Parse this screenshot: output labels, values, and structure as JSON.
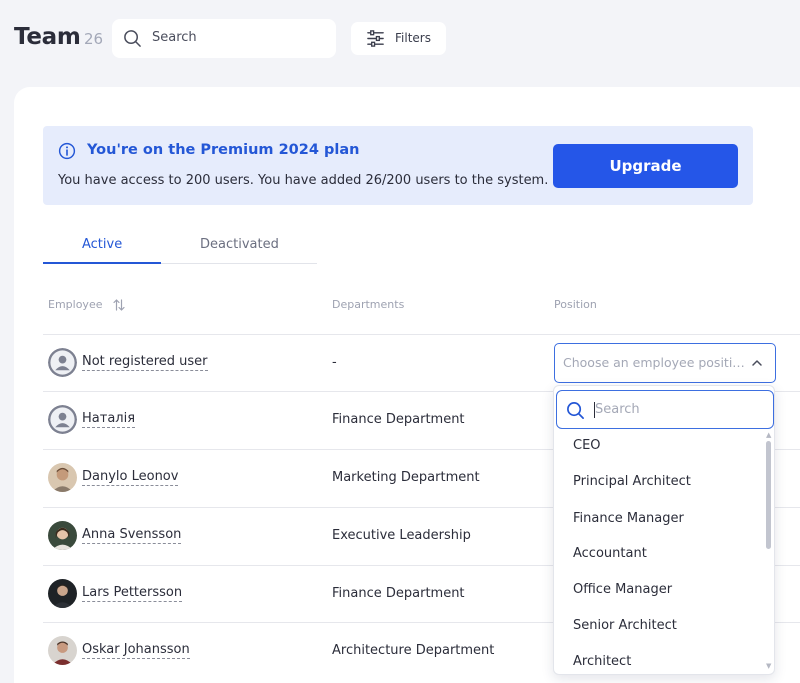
{
  "header": {
    "title": "Team",
    "count": "26",
    "search_placeholder": "Search",
    "filters_label": "Filters"
  },
  "banner": {
    "title": "You're on the Premium 2024 plan",
    "text": "You have access to 200 users. You have added 26/200 users to the system.",
    "upgrade_label": "Upgrade"
  },
  "tabs": [
    {
      "label": "Active",
      "active": true
    },
    {
      "label": "Deactivated",
      "active": false
    }
  ],
  "table": {
    "columns": [
      "Employee",
      "Departments",
      "Position"
    ],
    "rows": [
      {
        "name": "Not registered user",
        "department": "-",
        "avatar": "placeholder"
      },
      {
        "name": "Наталія",
        "department": "Finance Department",
        "avatar": "placeholder"
      },
      {
        "name": "Danylo Leonov",
        "department": "Marketing Department",
        "avatar": "photo"
      },
      {
        "name": "Anna Svensson",
        "department": "Executive Leadership",
        "avatar": "photo"
      },
      {
        "name": "Lars Pettersson",
        "department": "Finance Department",
        "avatar": "photo"
      },
      {
        "name": "Oskar Johansson",
        "department": "Architecture Department",
        "avatar": "photo"
      }
    ]
  },
  "position_select": {
    "placeholder": "Choose an employee position",
    "search_placeholder": "Search",
    "options": [
      "CEO",
      "Principal Architect",
      "Finance Manager",
      "Accountant",
      "Office Manager",
      "Senior Architect",
      "Architect"
    ]
  },
  "colors": {
    "accent": "#2457d6",
    "button": "#2556e8",
    "banner_bg": "#e6ecfc",
    "page_bg": "#f3f4f8"
  }
}
